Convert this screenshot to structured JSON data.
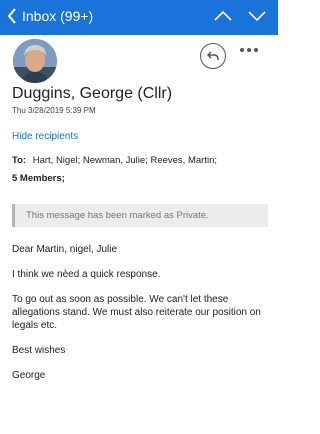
{
  "topbar": {
    "inbox_label": "Inbox (99+)"
  },
  "message": {
    "sender": "Duggins, George (Cllr)",
    "date": "Thu 3/28/2019 5:39 PM",
    "hide_recipients": "Hide recipients",
    "to_label": "To:",
    "recipients": [
      "Hart, Nigel;",
      "Newman, Julie;",
      "Reeves, Martin;"
    ],
    "members": "5 Members;",
    "private_notice": "This message has been marked as Private.",
    "body": [
      "Dear Martin, nigel, Julie",
      "I think we nèed a quick response.",
      "To go out as soon as possible. We can't let these allegations stand. We must also reiterate our position on legals etc.",
      "Best wishes",
      "George"
    ]
  },
  "colors": {
    "accent": "#1a73d9",
    "banner_bg": "#ececec"
  },
  "icons": {
    "back": "chevron-left-icon",
    "up": "chevron-up-icon",
    "down": "chevron-down-icon",
    "reply": "reply-icon",
    "more": "more-horizontal-icon"
  }
}
